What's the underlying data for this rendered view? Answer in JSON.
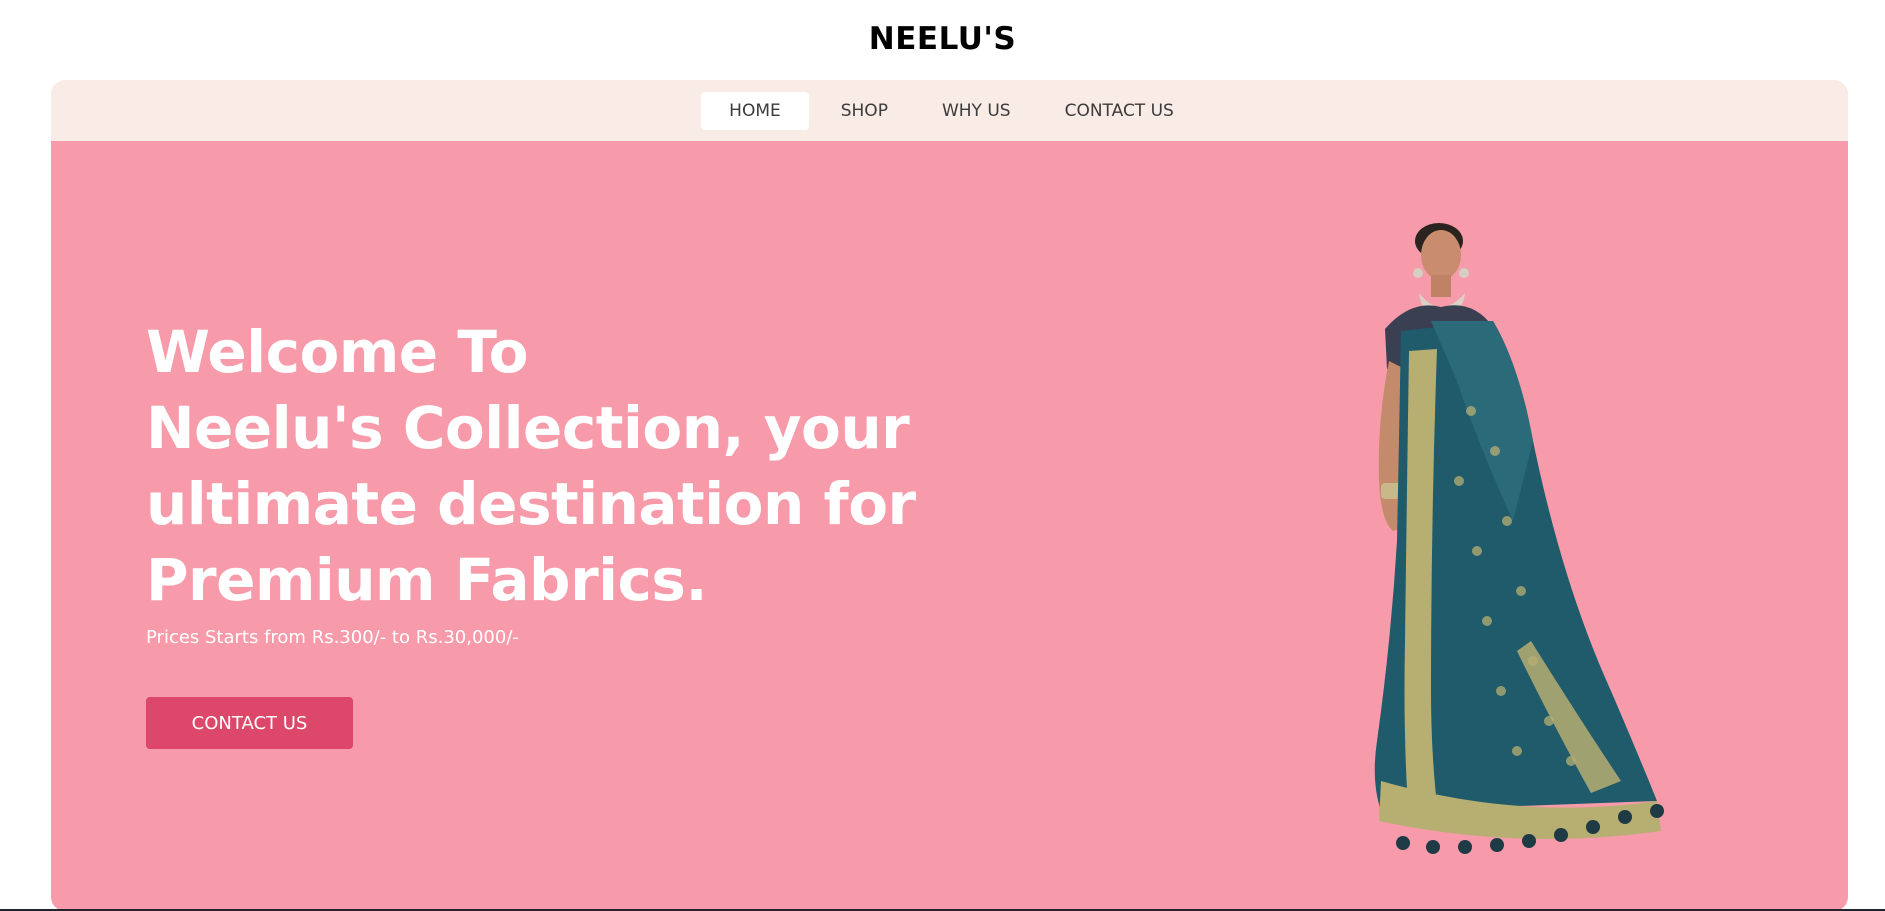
{
  "brand": {
    "title": "NEELU'S"
  },
  "nav": {
    "items": [
      {
        "label": "HOME",
        "active": true
      },
      {
        "label": "SHOP",
        "active": false
      },
      {
        "label": "WHY US",
        "active": false
      },
      {
        "label": "CONTACT US",
        "active": false
      }
    ]
  },
  "hero": {
    "heading_lines": [
      "Welcome To",
      "Neelu's Collection, your",
      "ultimate destination for",
      "Premium Fabrics."
    ],
    "subtext": "Prices Starts from Rs.300/- to Rs.30,000/-",
    "cta_label": "CONTACT US",
    "image_subject": "model-in-saree-image"
  },
  "colors": {
    "nav_bg": "#f9ebe6",
    "hero_bg": "#f79baa",
    "cta_bg": "#dd4769",
    "text_light": "#ffffff",
    "saree_teal": "#1f5b6b",
    "saree_gold": "#b7ae72"
  }
}
